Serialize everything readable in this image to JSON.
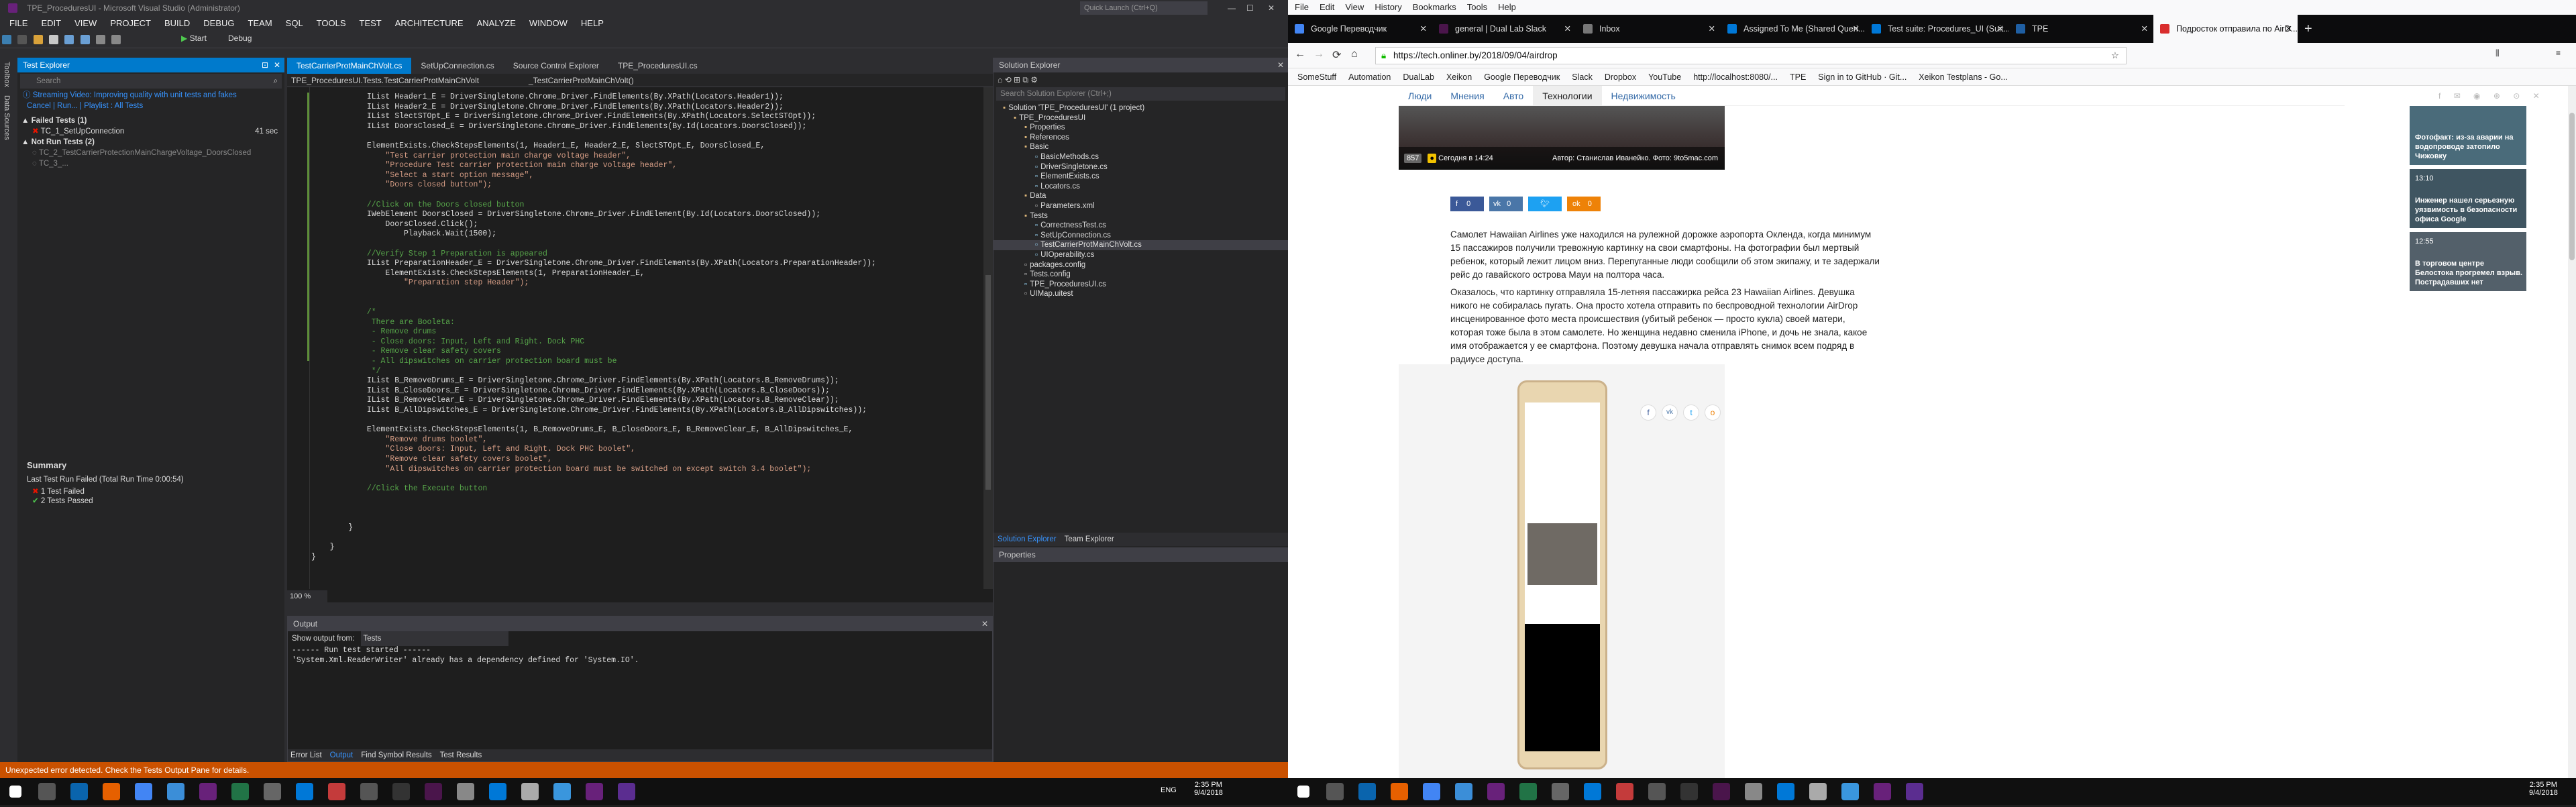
{
  "vs": {
    "title": "TPE_ProceduresUI - Microsoft Visual Studio (Administrator)",
    "quick_launch": "Quick Launch (Ctrl+Q)",
    "menu": [
      "FILE",
      "EDIT",
      "VIEW",
      "PROJECT",
      "BUILD",
      "DEBUG",
      "TEAM",
      "SQL",
      "TOOLS",
      "TEST",
      "ARCHITECTURE",
      "ANALYZE",
      "WINDOW",
      "HELP"
    ],
    "toolbar": {
      "start_label": "Start",
      "config": "Debug"
    },
    "side_labels": [
      "Toolbox",
      "Data Sources"
    ],
    "test_explorer": {
      "title": "Test Explorer",
      "search_placeholder": "Search",
      "promo": "Streaming Video: Improving quality with unit tests and fakes",
      "actions": "Cancel | Run... | Playlist : All Tests",
      "failed_header": "Failed Tests (1)",
      "failed_item": "TC_1_SetUpConnection",
      "failed_time": "41 sec",
      "notrun_header": "Not Run Tests (2)",
      "notrun_items": [
        "TC_2_TestCarrierProtectionMainChargeVoltage_DoorsClosed",
        "TC_3_..."
      ],
      "summary_title": "Summary",
      "summary_run": "Last Test Run Failed (Total Run Time 0:00:54)",
      "summary_failed": "1 Test Failed",
      "summary_passed": "2 Tests Passed"
    },
    "tabs": [
      "TestCarrierProtMainChVolt.cs",
      "SetUpConnection.cs",
      "Source Control Explorer",
      "TPE_ProceduresUI.cs"
    ],
    "breadcrumb_left": "TPE_ProceduresUI.Tests.TestCarrierProtMainChVolt",
    "breadcrumb_right": "_TestCarrierProtMainChVolt()",
    "code_lines": [
      "            IList Header1_E = DriverSingletone.Chrome_Driver.FindElements(By.XPath(Locators.Header1));",
      "            IList Header2_E = DriverSingletone.Chrome_Driver.FindElements(By.XPath(Locators.Header2));",
      "            IList SlectSTOpt_E = DriverSingletone.Chrome_Driver.FindElements(By.XPath(Locators.SelectSTOpt));",
      "            IList DoorsClosed_E = DriverSingletone.Chrome_Driver.FindElements(By.Id(Locators.DoorsClosed));",
      "",
      "            ElementExists.CheckStepsElements(1, Header1_E, Header2_E, SlectSTOpt_E, DoorsClosed_E,",
      "                \"Test carrier protection main charge voltage header\",",
      "                \"Procedure Test carrier protection main charge voltage header\",",
      "                \"Select a start option message\",",
      "                \"Doors closed button\");",
      "",
      "            //Click on the Doors closed button",
      "            IWebElement DoorsClosed = DriverSingletone.Chrome_Driver.FindElement(By.Id(Locators.DoorsClosed));",
      "                DoorsClosed.Click();",
      "                    Playback.Wait(1500);",
      "",
      "            //Verify Step 1 Preparation is appeared",
      "            IList PreparationHeader_E = DriverSingletone.Chrome_Driver.FindElements(By.XPath(Locators.PreparationHeader));",
      "                ElementExists.CheckStepsElements(1, PreparationHeader_E,",
      "                    \"Preparation step Header\");",
      "",
      "",
      "            /*",
      "             There are Booleta:",
      "             - Remove drums",
      "             - Close doors: Input, Left and Right. Dock PHC",
      "             - Remove clear safety covers",
      "             - All dipswitches on carrier protection board must be",
      "             */",
      "            IList B_RemoveDrums_E = DriverSingletone.Chrome_Driver.FindElements(By.XPath(Locators.B_RemoveDrums));",
      "            IList B_CloseDoors_E = DriverSingletone.Chrome_Driver.FindElements(By.XPath(Locators.B_CloseDoors));",
      "            IList B_RemoveClear_E = DriverSingletone.Chrome_Driver.FindElements(By.XPath(Locators.B_RemoveClear));",
      "            IList B_AllDipswitches_E = DriverSingletone.Chrome_Driver.FindElements(By.XPath(Locators.B_AllDipswitches));",
      "",
      "            ElementExists.CheckStepsElements(1, B_RemoveDrums_E, B_CloseDoors_E, B_RemoveClear_E, B_AllDipswitches_E,",
      "                \"Remove drums boolet\",",
      "                \"Close doors: Input, Left and Right. Dock PHC boolet\",",
      "                \"Remove clear safety covers boolet\",",
      "                \"All dipswitches on carrier protection board must be switched on except switch 3.4 boolet\");",
      "",
      "            //Click the Execute button",
      "",
      "",
      "",
      "        }",
      "",
      "    }",
      "}"
    ],
    "zoom": "100 %",
    "output": {
      "title": "Output",
      "show_from_label": "Show output from:",
      "show_from_value": "Tests",
      "lines": [
        "------ Run test started ------",
        "'System.Xml.ReaderWriter' already has a dependency defined for 'System.IO'."
      ]
    },
    "bottom_tabs": [
      "Error List",
      "Output",
      "Find Symbol Results",
      "Test Results"
    ],
    "solution_explorer": {
      "title": "Solution Explorer",
      "search_placeholder": "Search Solution Explorer (Ctrl+;)",
      "tree": [
        "Solution 'TPE_ProceduresUI' (1 project)",
        "TPE_ProceduresUI",
        "Properties",
        "References",
        "Basic",
        "BasicMethods.cs",
        "DriverSingletone.cs",
        "ElementExists.cs",
        "Locators.cs",
        "Data",
        "Parameters.xml",
        "Tests",
        "CorrectnessTest.cs",
        "SetUpConnection.cs",
        "TestCarrierProtMainChVolt.cs",
        "UIOperability.cs",
        "packages.config",
        "Tests.config",
        "TPE_ProceduresUI.cs",
        "UIMap.uitest"
      ],
      "tabs": [
        "Solution Explorer",
        "Team Explorer"
      ]
    },
    "properties_title": "Properties",
    "status": "Unexpected error detected. Check the Tests Output Pane for details."
  },
  "firefox": {
    "menu": [
      "File",
      "Edit",
      "View",
      "History",
      "Bookmarks",
      "Tools",
      "Help"
    ],
    "tabs": [
      "Google Переводчик",
      "general | Dual Lab Slack",
      "Inbox",
      "Assigned To Me (Shared Queri...",
      "Test suite: Procedures_UI (Suit...",
      "TPE",
      "Подросток отправила по AirD..."
    ],
    "url": "https://tech.onliner.by/2018/09/04/airdrop",
    "bookmarks": [
      "SomeStuff",
      "Automation",
      "DualLab",
      "Xeikon",
      "Google Переводчик",
      "Slack",
      "Dropbox",
      "YouTube",
      "http://localhost:8080/...",
      "TPE",
      "Sign in to GitHub · Git...",
      "Xeikon Testplans - Go..."
    ],
    "site_nav": [
      "Люди",
      "Мнения",
      "Авто",
      "Технологии",
      "Недвижимость"
    ],
    "photo_caption_count": "857",
    "photo_caption_date": "Сегодня в 14:24",
    "photo_credit": "Автор: Станислав Иванейко. Фото: 9to5mac.com",
    "share_counts": [
      "0",
      "0",
      "",
      "0"
    ],
    "paragraph1": "Самолет Hawaiian Airlines уже находился на рулежной дорожке аэропорта Окленда, когда минимум 15 пассажиров получили тревожную картинку на свои смартфоны. На фотографии был мертвый ребенок, который лежит лицом вниз. Перепуганные люди сообщили об этом экипажу, и те задержали рейс до гавайского острова Мауи на полтора часа.",
    "paragraph2": "Оказалось, что картинку отправляла 15-летняя пассажирка рейса 23 Hawaiian Airlines. Девушка никого не собиралась пугать. Она просто хотела отправить по беспроводной технологии AirDrop инсценированное фото места происшествия (убитый ребенок — просто кукла) своей матери, которая тоже была в этом самолете. Но женщина недавно сменила iPhone, и дочь не знала, какое имя отображается у ее смартфона. Поэтому девушка начала отправлять снимок всем подряд в радиусе доступа.",
    "sidebar_news": [
      {
        "time": "",
        "title": "Фотофакт: из-за аварии на водопроводе затопило Чижовку"
      },
      {
        "time": "13:10",
        "title": "Инженер нашел серьезную уязвимость в безопасности офиса Google"
      },
      {
        "time": "12:55",
        "title": "В торговом центре Белостока прогремел взрыв. Пострадавших нет"
      }
    ]
  },
  "taskbar": {
    "lang": "ENG",
    "time": "2:35 PM",
    "date": "9/4/2018"
  },
  "colors": {
    "vs_accent": "#007acc",
    "vs_status": "#ca5100",
    "ff_tabs": "#0c0c0d",
    "onliner_blue": "#4a78a6"
  }
}
